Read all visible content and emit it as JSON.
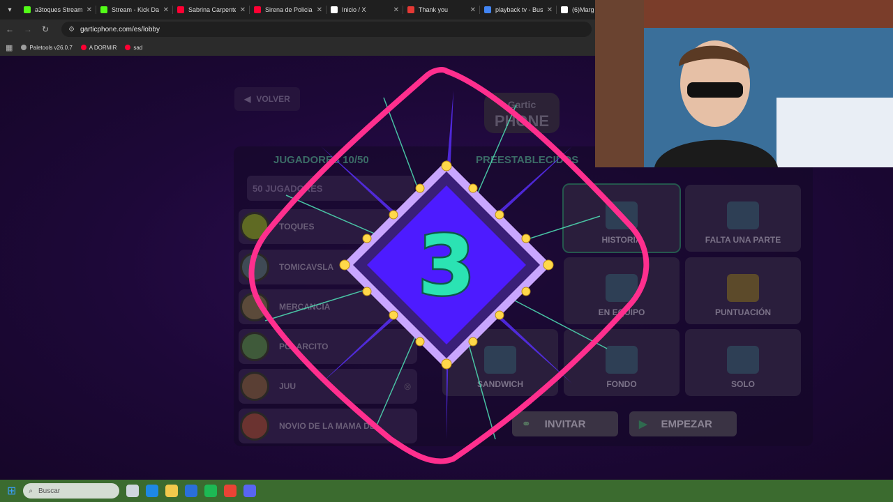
{
  "browser": {
    "tabs": [
      {
        "title": "a3toques Stream",
        "color": "#53fc18"
      },
      {
        "title": "Stream - Kick Das",
        "color": "#53fc18"
      },
      {
        "title": "Sabrina Carpente",
        "color": "#ff0033"
      },
      {
        "title": "Sirena de Policia",
        "color": "#ff0033"
      },
      {
        "title": "Inicio / X",
        "color": "#ffffff"
      },
      {
        "title": "Thank you",
        "color": "#e53935"
      },
      {
        "title": "playback tv - Busc",
        "color": "#4285f4"
      },
      {
        "title": "(6)Marg",
        "color": "#ffffff"
      }
    ],
    "url": "garticphone.com/es/lobby",
    "bookmarks": [
      {
        "label": "Paletools v26.0.7",
        "color": "#9e9e9e"
      },
      {
        "label": "A DORMIR",
        "color": "#ff0033"
      },
      {
        "label": "sad",
        "color": "#ff0033"
      }
    ]
  },
  "lobby": {
    "back_label": "VOLVER",
    "logo_top": "Gartic",
    "logo_bottom": "PHONE",
    "players_title": "JUGADORES 10/50",
    "players_input": "50 JUGADORES",
    "players": [
      {
        "name": "TOQUES"
      },
      {
        "name": "TOMICAVSLA"
      },
      {
        "name": "MERCANCÍA"
      },
      {
        "name": "POLARCITO"
      },
      {
        "name": "JUU"
      },
      {
        "name": "NOVIO DE LA MAMA DE"
      }
    ],
    "presets_title": "PREESTABLECIDOS",
    "presets": [
      {
        "label": "HISTORIA"
      },
      {
        "label": "FALTA UNA PARTE"
      },
      {
        "label": "EN EQUIPO"
      },
      {
        "label": "PUNTUACIÓN"
      },
      {
        "label": "SANDWICH"
      },
      {
        "label": "FONDO"
      },
      {
        "label": "SOLO"
      }
    ],
    "invite_label": "INVITAR",
    "start_label": "EMPEZAR"
  },
  "countdown": {
    "value": "3"
  },
  "taskbar": {
    "search_placeholder": "Buscar"
  }
}
